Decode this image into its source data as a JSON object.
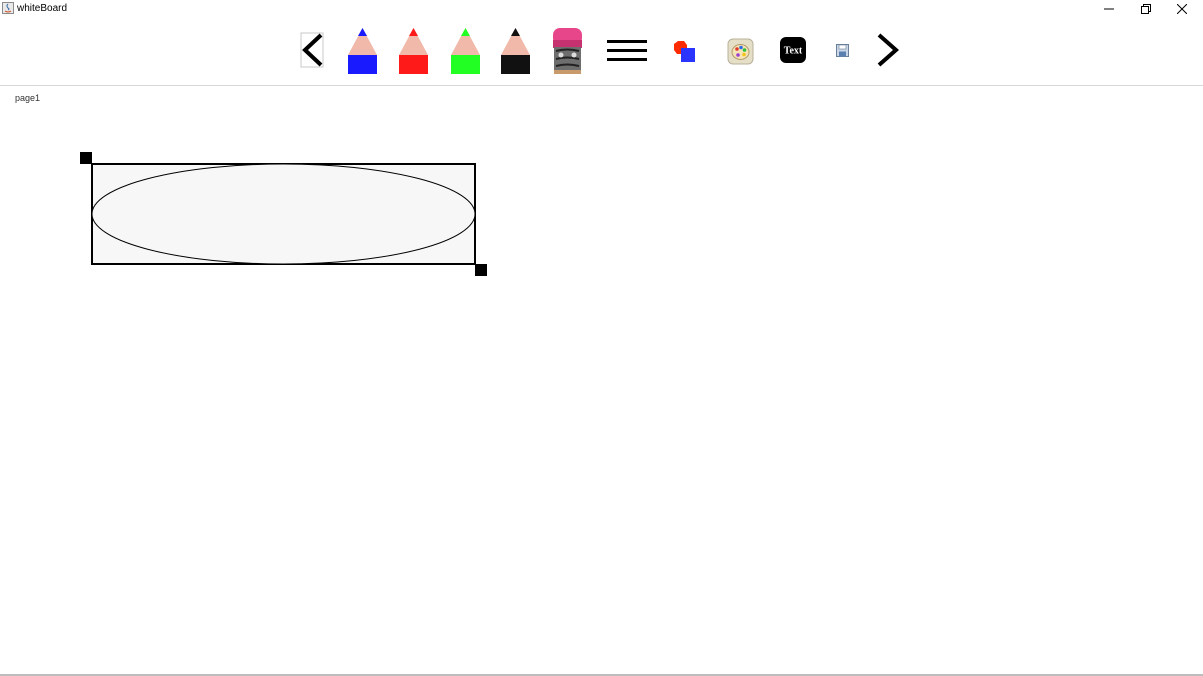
{
  "window": {
    "title": "whiteBoard"
  },
  "toolbar": {
    "tools": [
      {
        "name": "previous-page",
        "icon": "chevron-left-icon"
      },
      {
        "name": "blue-pencil",
        "icon": "pencil-icon",
        "color": "#1a1aff"
      },
      {
        "name": "red-pencil",
        "icon": "pencil-icon",
        "color": "#ff1a1a"
      },
      {
        "name": "green-pencil",
        "icon": "pencil-icon",
        "color": "#22ff22"
      },
      {
        "name": "black-pencil",
        "icon": "pencil-icon",
        "color": "#111111"
      },
      {
        "name": "eraser",
        "icon": "eraser-icon",
        "color": "#e8468a"
      },
      {
        "name": "line-width",
        "icon": "lines-icon"
      },
      {
        "name": "shapes",
        "icon": "shapes-icon"
      },
      {
        "name": "color-palette",
        "icon": "palette-icon"
      },
      {
        "name": "text-tool",
        "icon": "text-icon",
        "label": "Text"
      },
      {
        "name": "save",
        "icon": "floppy-disk-icon"
      },
      {
        "name": "next-page",
        "icon": "chevron-right-icon"
      }
    ]
  },
  "canvas": {
    "page_label": "page1",
    "selected_shape": "ellipse",
    "fill_color": "#f7f7f7",
    "stroke_color": "#000000"
  }
}
